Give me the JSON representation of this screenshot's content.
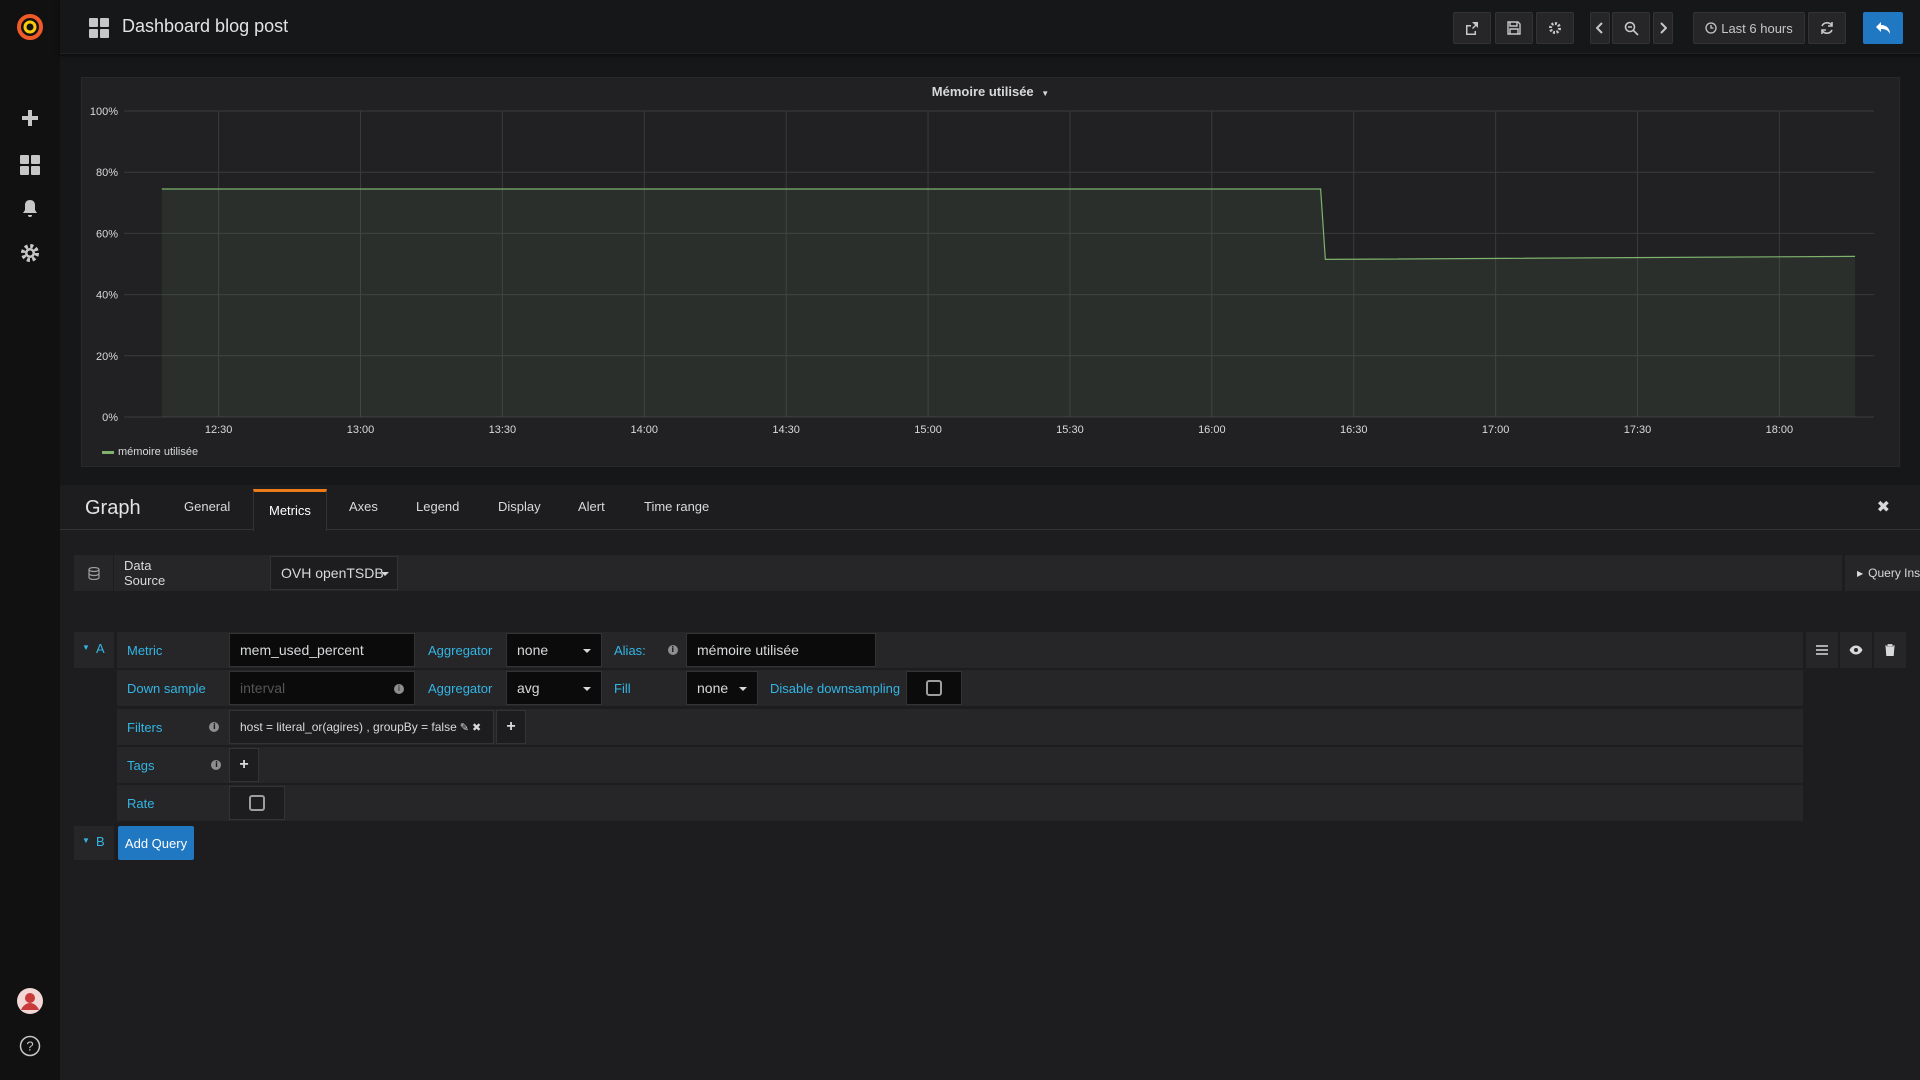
{
  "topbar": {
    "title": "Dashboard blog post",
    "time_range": "Last 6 hours"
  },
  "colors": {
    "accent": "#eb7b18",
    "primary": "#1f78c1",
    "series": "#7eb26d",
    "label_blue": "#33b5e5"
  },
  "panel": {
    "title": "Mémoire utilisée",
    "legend": "mémoire utilisée"
  },
  "chart_data": {
    "type": "area",
    "title": "Mémoire utilisée",
    "y_ticks": [
      "100%",
      "80%",
      "60%",
      "40%",
      "20%",
      "0%"
    ],
    "ylim": [
      0,
      100
    ],
    "x_ticks": [
      "12:30",
      "13:00",
      "13:30",
      "14:00",
      "14:30",
      "15:00",
      "15:30",
      "16:00",
      "16:30",
      "17:00",
      "17:30",
      "18:00"
    ],
    "grid": true,
    "legend_position": "bottom-left",
    "series": [
      {
        "name": "mémoire utilisée",
        "x": [
          "12:18",
          "16:23",
          "16:24",
          "18:16"
        ],
        "values": [
          74.5,
          74.5,
          51.5,
          52.5
        ]
      }
    ]
  },
  "editor": {
    "title": "Graph",
    "tabs": [
      "General",
      "Metrics",
      "Axes",
      "Legend",
      "Display",
      "Alert",
      "Time range"
    ],
    "active_tab": "Metrics",
    "datasource_label": "Data Source",
    "datasource_value": "OVH openTSDB",
    "query_inspector": "Query Inspector",
    "query_a": {
      "letter": "A",
      "metric_label": "Metric",
      "metric_value": "mem_used_percent",
      "aggregator_label": "Aggregator",
      "aggregator_value": "none",
      "alias_label": "Alias:",
      "alias_value": "mémoire utilisée",
      "downsample_label": "Down sample",
      "downsample_placeholder": "interval",
      "aggregator2_label": "Aggregator",
      "aggregator2_value": "avg",
      "fill_label": "Fill",
      "fill_value": "none",
      "disable_downsampling_label": "Disable downsampling",
      "filters_label": "Filters",
      "filter_value": "host = literal_or(agires) , groupBy = false",
      "tags_label": "Tags",
      "rate_label": "Rate"
    },
    "query_b": {
      "letter": "B",
      "add_query": "Add Query"
    }
  }
}
